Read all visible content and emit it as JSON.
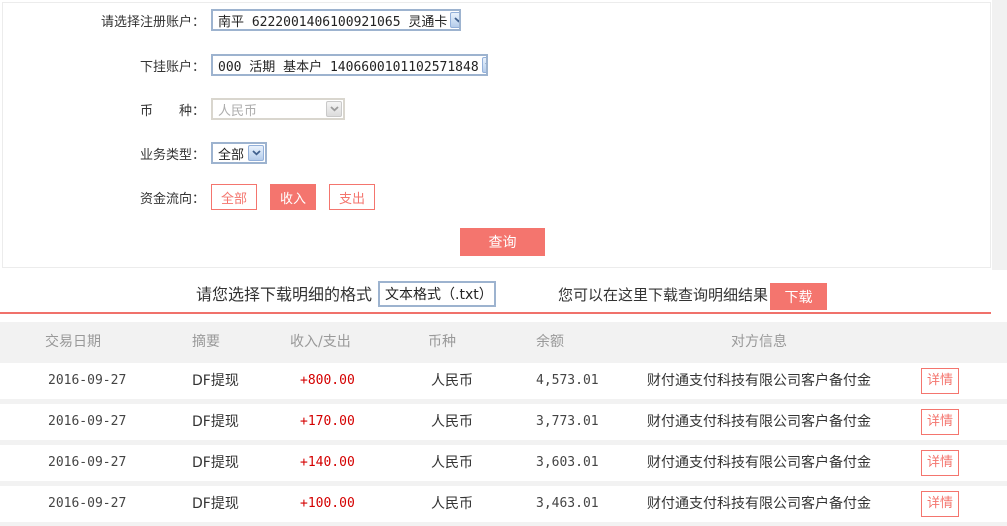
{
  "accent_color": "#f4756e",
  "amount_color": "#d40000",
  "form": {
    "register_account": {
      "label": "请选择注册账户：",
      "value": "南平 6222001406100921065 灵通卡"
    },
    "sub_account": {
      "label": "下挂账户：",
      "value": "000 活期 基本户 1406600101102571848"
    },
    "currency": {
      "label": "币　　种：",
      "value": "人民币"
    },
    "business_type": {
      "label": "业务类型：",
      "value": "全部"
    },
    "fund_flow": {
      "label": "资金流向：",
      "options": [
        {
          "label": "全部",
          "active": false
        },
        {
          "label": "收入",
          "active": true
        },
        {
          "label": "支出",
          "active": false
        }
      ]
    },
    "query_button": "查询"
  },
  "download": {
    "format_label": "请您选择下载明细的格式",
    "format_value": "文本格式（.txt）",
    "hint": "您可以在这里下载查询明细结果",
    "button": "下载"
  },
  "table": {
    "headers": {
      "date": "交易日期",
      "summary": "摘要",
      "in_out": "收入/支出",
      "currency": "币种",
      "balance": "余额",
      "counterparty": "对方信息"
    },
    "detail_label": "详情",
    "rows": [
      {
        "date": "2016-09-27",
        "summary": "DF提现",
        "amount": "+800.00",
        "currency": "人民币",
        "balance": "4,573.01",
        "counterparty": "财付通支付科技有限公司客户备付金"
      },
      {
        "date": "2016-09-27",
        "summary": "DF提现",
        "amount": "+170.00",
        "currency": "人民币",
        "balance": "3,773.01",
        "counterparty": "财付通支付科技有限公司客户备付金"
      },
      {
        "date": "2016-09-27",
        "summary": "DF提现",
        "amount": "+140.00",
        "currency": "人民币",
        "balance": "3,603.01",
        "counterparty": "财付通支付科技有限公司客户备付金"
      },
      {
        "date": "2016-09-27",
        "summary": "DF提现",
        "amount": "+100.00",
        "currency": "人民币",
        "balance": "3,463.01",
        "counterparty": "财付通支付科技有限公司客户备付金"
      }
    ]
  }
}
